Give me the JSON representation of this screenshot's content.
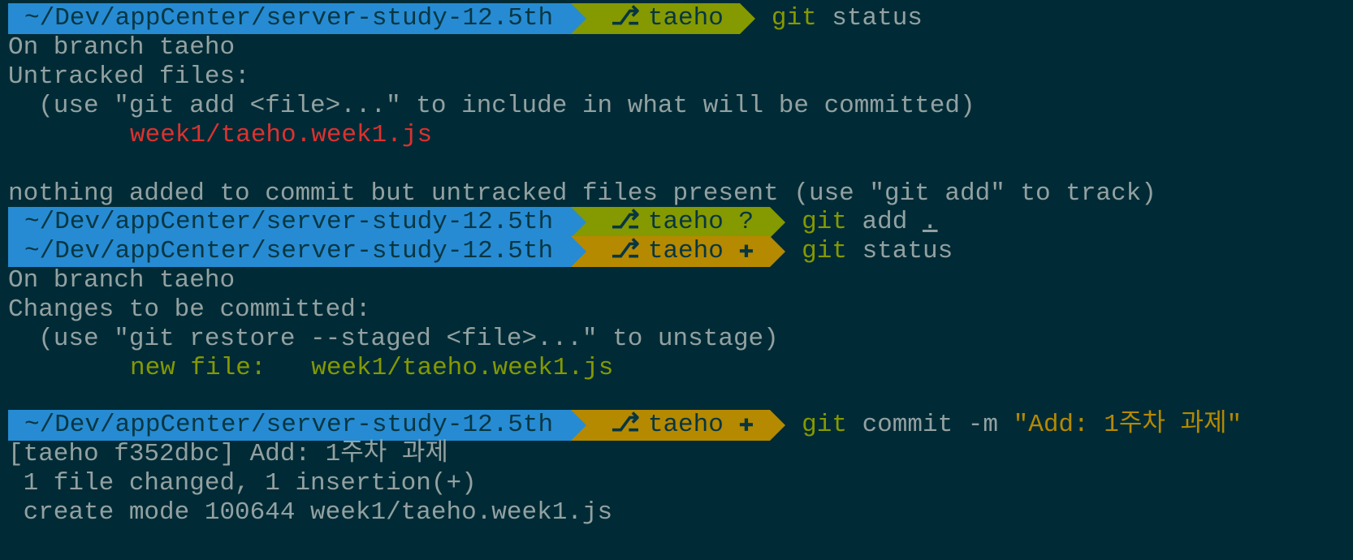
{
  "prompt_path": "~/Dev/appCenter/server-study-12.5th",
  "branch_icon": "",
  "branch": "taeho",
  "colors": {
    "background": "#002b36",
    "path_segment": "#268bd2",
    "git_clean": "#859900",
    "git_dirty_staged": "#b58900",
    "text": "#93a1a1",
    "untracked_file": "#dc322f",
    "new_file": "#859900",
    "string": "#b58900"
  },
  "block1": {
    "prompt_status": "",
    "command_word": "git",
    "command_args": "status",
    "output": [
      "On branch taeho",
      "Untracked files:",
      "  (use \"git add <file>...\" to include in what will be committed)"
    ],
    "untracked_file": "week1/taeho.week1.js",
    "summary": "nothing added to commit but untracked files present (use \"git add\" to track)"
  },
  "block2": {
    "prompt_status": " ?",
    "command_word": "git",
    "command_args": "add",
    "command_target": "."
  },
  "block3": {
    "prompt_status": " ✚",
    "command_word": "git",
    "command_args": "status",
    "output": [
      "On branch taeho",
      "Changes to be committed:",
      "  (use \"git restore --staged <file>...\" to unstage)"
    ],
    "new_file_label": "new file:",
    "new_file_path": "week1/taeho.week1.js"
  },
  "block4": {
    "prompt_status": " ✚",
    "command_word": "git",
    "command_args": "commit -m",
    "command_message": "\"Add: 1주차 과제\"",
    "output": [
      "[taeho f352dbc] Add: 1주차 과제",
      " 1 file changed, 1 insertion(+)",
      " create mode 100644 week1/taeho.week1.js"
    ]
  }
}
